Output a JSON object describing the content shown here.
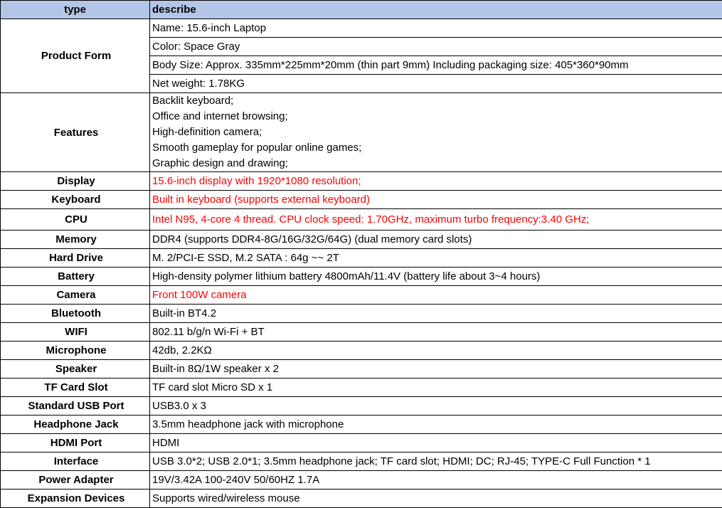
{
  "header": {
    "type": "type",
    "describe": "describe"
  },
  "product_form": {
    "label": "Product Form",
    "lines": [
      "Name: 15.6-inch Laptop",
      "Color: Space Gray",
      "Body Size: Approx. 335mm*225mm*20mm (thin part 9mm) Including packaging size: 405*360*90mm",
      "Net weight: 1.78KG"
    ]
  },
  "features": {
    "label": "Features",
    "lines": [
      "Backlit keyboard;",
      "Office and internet browsing;",
      "High-definition camera;",
      "Smooth gameplay for popular online games;",
      "Graphic design and drawing;"
    ]
  },
  "rows": [
    {
      "label": "Display",
      "value": "15.6-inch display with 1920*1080 resolution;",
      "highlight": true
    },
    {
      "label": "Keyboard",
      "value": "Built in keyboard (supports external keyboard)",
      "highlight": true
    },
    {
      "label": "CPU",
      "value": "Intel N95, 4-core 4 thread. CPU clock speed: 1.70GHz, maximum turbo frequency:3.40 GHz;",
      "highlight": true
    },
    {
      "label": "Memory",
      "value": "DDR4 (supports DDR4-8G/16G/32G/64G) (dual memory card slots)",
      "highlight": false
    },
    {
      "label": "Hard Drive",
      "value": "M. 2/PCI-E SSD, M.2 SATA : 64g ~~ 2T",
      "highlight": false
    },
    {
      "label": "Battery",
      "value": "High-density polymer lithium battery 4800mAh/11.4V (battery life about 3~4 hours)",
      "highlight": false
    },
    {
      "label": "Camera",
      "value": "Front 100W camera",
      "highlight": true
    },
    {
      "label": "Bluetooth",
      "value": "Built-in BT4.2",
      "highlight": false
    },
    {
      "label": "WIFI",
      "value": "802.11 b/g/n Wi-Fi + BT",
      "highlight": false
    },
    {
      "label": "Microphone",
      "value": "42db, 2.2KΩ",
      "highlight": false
    },
    {
      "label": "Speaker",
      "value": "Built-in 8Ω/1W speaker x 2",
      "highlight": false
    },
    {
      "label": "TF Card Slot",
      "value": "TF card slot Micro SD x 1",
      "highlight": false
    },
    {
      "label": "Standard USB Port",
      "value": "USB3.0 x 3",
      "highlight": false
    },
    {
      "label": "Headphone Jack",
      "value": "3.5mm headphone jack with microphone",
      "highlight": false
    },
    {
      "label": "HDMI Port",
      "value": "HDMI",
      "highlight": false
    },
    {
      "label": "Interface",
      "value": "USB 3.0*2;  USB 2.0*1; 3.5mm headphone jack;  TF card slot;  HDMI;  DC;  RJ-45;   TYPE-C Full Function * 1",
      "highlight": false
    },
    {
      "label": "Power Adapter",
      "value": "19V/3.42A 100-240V 50/60HZ 1.7A",
      "highlight": false
    },
    {
      "label": "Expansion Devices",
      "value": "Supports wired/wireless mouse",
      "highlight": false
    }
  ],
  "colors": {
    "header_bg": "#b4c6e7",
    "highlight_text": "#ff0000"
  }
}
